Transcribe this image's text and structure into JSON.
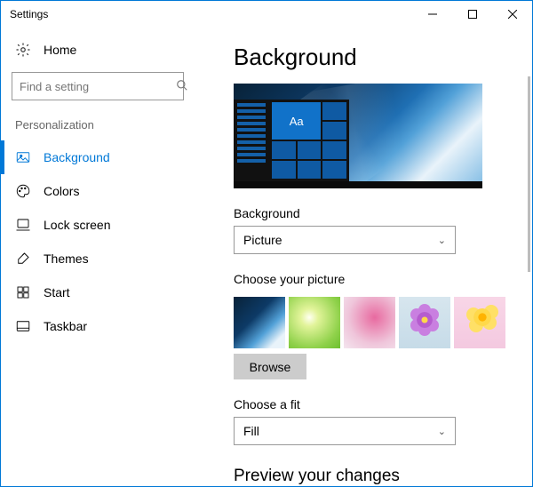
{
  "window": {
    "title": "Settings"
  },
  "sidebar": {
    "home_label": "Home",
    "search_placeholder": "Find a setting",
    "section_header": "Personalization",
    "items": [
      {
        "label": "Background",
        "icon": "picture-icon",
        "active": true
      },
      {
        "label": "Colors",
        "icon": "palette-icon",
        "active": false
      },
      {
        "label": "Lock screen",
        "icon": "lockscreen-icon",
        "active": false
      },
      {
        "label": "Themes",
        "icon": "themes-icon",
        "active": false
      },
      {
        "label": "Start",
        "icon": "start-icon",
        "active": false
      },
      {
        "label": "Taskbar",
        "icon": "taskbar-icon",
        "active": false
      }
    ]
  },
  "main": {
    "page_title": "Background",
    "preview_sample_text": "Aa",
    "background_select": {
      "label": "Background",
      "value": "Picture"
    },
    "choose_picture_label": "Choose your picture",
    "browse_label": "Browse",
    "fit_select": {
      "label": "Choose a fit",
      "value": "Fill"
    },
    "preview_changes_heading": "Preview your changes"
  }
}
